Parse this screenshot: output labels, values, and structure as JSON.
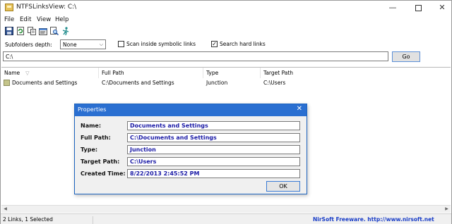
{
  "window": {
    "title": "NTFSLinksView:  C:\\",
    "minimize": "—",
    "close": "✕"
  },
  "menu": [
    "File",
    "Edit",
    "View",
    "Help"
  ],
  "toolbar": {
    "icons": [
      "save-icon",
      "refresh-icon",
      "copy-icon",
      "properties-icon",
      "find-icon",
      "exit-icon"
    ]
  },
  "options": {
    "subfolders_label": "Subfolders depth:",
    "subfolders_value": "None",
    "scan_symbolic_label": "Scan inside symbolic links",
    "scan_symbolic_checked": false,
    "search_hard_label": "Search hard links",
    "search_hard_checked": true
  },
  "path": {
    "value": "C:\\",
    "go_label": "Go"
  },
  "list": {
    "columns": [
      "Name",
      "Full Path",
      "Type",
      "Target Path"
    ],
    "rows": [
      {
        "name": "Documents and Settings",
        "full_path": "C:\\Documents and Settings",
        "type": "Junction",
        "target_path": "C:\\Users"
      }
    ]
  },
  "status": {
    "left": "2 Links, 1 Selected",
    "right": "NirSoft Freeware.  http://www.nirsoft.net"
  },
  "dialog": {
    "title": "Properties",
    "close": "✕",
    "fields": [
      {
        "label": "Name:",
        "value": "Documents and Settings"
      },
      {
        "label": "Full Path:",
        "value": "C:\\Documents and Settings"
      },
      {
        "label": "Type:",
        "value": "Junction"
      },
      {
        "label": "Target Path:",
        "value": "C:\\Users"
      },
      {
        "label": "Created Time:",
        "value": "8/22/2013 2:45:52 PM"
      }
    ],
    "ok_label": "OK"
  },
  "colors": {
    "accent": "#2a6fd1",
    "field_text": "#1a1aa6",
    "link": "#1a3ec7"
  }
}
